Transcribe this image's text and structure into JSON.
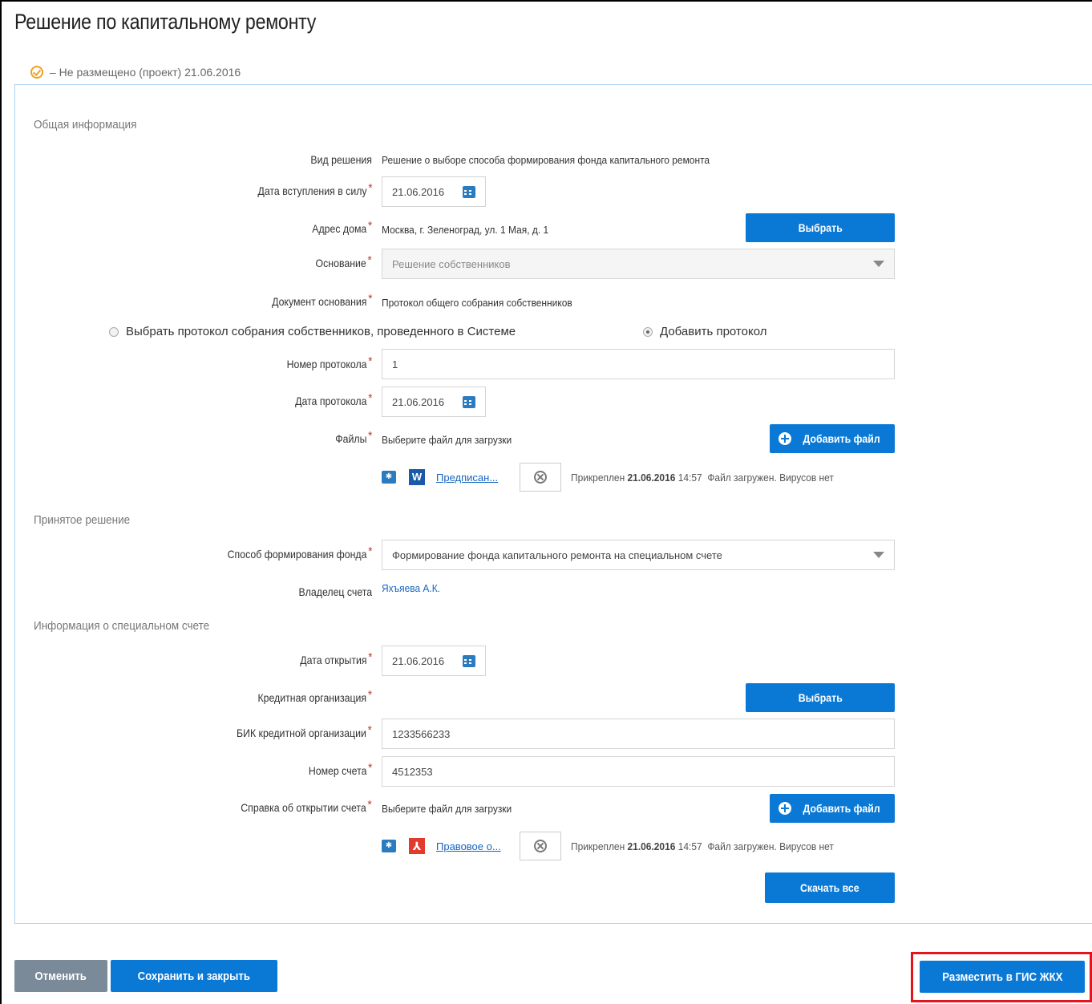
{
  "page_title": "Решение по капитальному ремонту",
  "status": {
    "text": "– Не размещено (проект) 21.06.2016"
  },
  "sections": {
    "general": "Общая информация",
    "decision": "Принятое решение",
    "special_account": "Информация о специальном счете"
  },
  "fields": {
    "decision_type": {
      "label": "Вид решения",
      "value": "Решение о выборе способа формирования фонда капитального ремонта"
    },
    "effective_date": {
      "label": "Дата вступления в силу",
      "value": "21.06.2016"
    },
    "house_address": {
      "label": "Адрес дома",
      "value": "Москва, г. Зеленоград, ул. 1 Мая, д. 1",
      "button": "Выбрать"
    },
    "basis": {
      "label": "Основание",
      "value": "Решение собственников"
    },
    "basis_document": {
      "label": "Документ основания",
      "value": "Протокол общего собрания собственников"
    },
    "radio_select_protocol": "Выбрать протокол собрания собственников, проведенного в Системе",
    "radio_add_protocol": "Добавить протокол",
    "protocol_number": {
      "label": "Номер протокола",
      "value": "1"
    },
    "protocol_date": {
      "label": "Дата протокола",
      "value": "21.06.2016"
    },
    "files": {
      "label": "Файлы",
      "placeholder": "Выберите файл для загрузки",
      "button": "Добавить файл",
      "file_name": "Предписан...",
      "attached_prefix": "Прикреплен",
      "attached_date": "21.06.2016",
      "attached_time": "14:57",
      "attached_status": "Файл загружен. Вирусов нет"
    },
    "fund_method": {
      "label": "Способ формирования фонда",
      "value": "Формирование фонда капитального ремонта на специальном счете"
    },
    "account_owner": {
      "label": "Владелец счета",
      "value": "Яхъяева А.К."
    },
    "open_date": {
      "label": "Дата открытия",
      "value": "21.06.2016"
    },
    "credit_org": {
      "label": "Кредитная организация",
      "button": "Выбрать"
    },
    "bik": {
      "label": "БИК кредитной организации",
      "value": "1233566233"
    },
    "account_number": {
      "label": "Номер счета",
      "value": "4512353"
    },
    "account_certificate": {
      "label": "Справка об открытии счета",
      "placeholder": "Выберите файл для загрузки",
      "button": "Добавить файл",
      "file_name": "Правовое о...",
      "attached_prefix": "Прикреплен",
      "attached_date": "21.06.2016",
      "attached_time": "14:57",
      "attached_status": "Файл загружен. Вирусов нет"
    },
    "download_all": "Скачать все"
  },
  "footer": {
    "cancel": "Отменить",
    "save_close": "Сохранить и закрыть",
    "publish": "Разместить в ГИС ЖКХ"
  },
  "colors": {
    "primary": "#0a79d6",
    "required": "#c0392b",
    "highlight": "#e3141b",
    "status_icon": "#f0a020"
  }
}
